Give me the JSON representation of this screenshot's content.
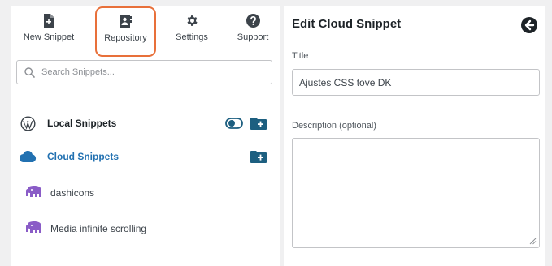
{
  "toolbar": {
    "new_snippet": "New Snippet",
    "repository": "Repository",
    "settings": "Settings",
    "support": "Support"
  },
  "search": {
    "placeholder": "Search Snippets...",
    "value": ""
  },
  "sections": {
    "local": "Local Snippets",
    "cloud": "Cloud Snippets"
  },
  "snippets": [
    {
      "label": "dashicons",
      "icon": "elephant-icon"
    },
    {
      "label": "Media infinite scrolling",
      "icon": "elephant-icon"
    }
  ],
  "editor": {
    "heading": "Edit Cloud Snippet",
    "title_label": "Title",
    "title_value": "Ajustes CSS tove DK",
    "description_label": "Description (optional)",
    "description_value": ""
  },
  "colors": {
    "accent_highlight": "#e8703a",
    "cloud_blue": "#2271b1",
    "snippet_icon_purple": "#8a5cc7",
    "folder_teal": "#1d5f80"
  }
}
